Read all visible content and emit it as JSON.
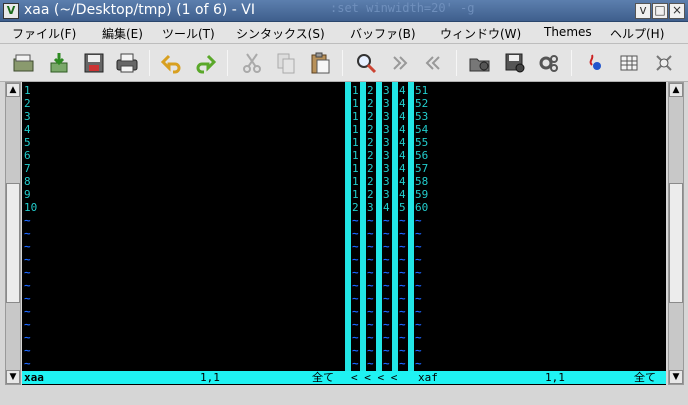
{
  "window": {
    "title": "xaa (~/Desktop/tmp) (1 of 6) - VI",
    "ghost_text": ":set winwidth=20' -g",
    "app_icon": "vim-icon",
    "controls": {
      "minimize": "v",
      "maximize": "□",
      "close": "×"
    }
  },
  "menu": [
    "ファイル(F)",
    "編集(E)",
    "ツール(T)",
    "シンタックス(S)",
    "バッファ(B)",
    "ウィンドウ(W)",
    "Themes",
    "ヘルプ(H)"
  ],
  "toolbar_icons": [
    "open-icon",
    "save-down-icon",
    "save-icon",
    "print-icon",
    "undo-icon",
    "redo-icon",
    "cut-icon",
    "copy-icon",
    "paste-icon",
    "find-replace-icon",
    "forward-icon",
    "back-icon",
    "session-open-icon",
    "session-save-icon",
    "script-icon",
    "make-icon",
    "table-icon",
    "help-icon"
  ],
  "editor": {
    "left_lines": [
      "1",
      "2",
      "3",
      "4",
      "5",
      "6",
      "7",
      "8",
      "9",
      "10"
    ],
    "narrow_rows": [
      [
        "1",
        "2",
        "3",
        "4",
        "51"
      ],
      [
        "1",
        "2",
        "3",
        "4",
        "52"
      ],
      [
        "1",
        "2",
        "3",
        "4",
        "53"
      ],
      [
        "1",
        "2",
        "3",
        "4",
        "54"
      ],
      [
        "1",
        "2",
        "3",
        "4",
        "55"
      ],
      [
        "1",
        "2",
        "3",
        "4",
        "56"
      ],
      [
        "1",
        "2",
        "3",
        "4",
        "57"
      ],
      [
        "1",
        "2",
        "3",
        "4",
        "58"
      ],
      [
        "1",
        "2",
        "3",
        "4",
        "59"
      ],
      [
        "2",
        "3",
        "4",
        "5",
        "60"
      ]
    ],
    "tilde": "~",
    "status": {
      "left_name": "xaa",
      "left_pos": "1,1",
      "left_all": "全て",
      "mids": "< < < <",
      "right_name": "xaf",
      "right_pos": "1,1",
      "right_all": "全て"
    }
  },
  "colors": {
    "text": "#22cccc",
    "tilde": "#1a66ff",
    "statusline": "#1ff2f2",
    "bg": "#000000"
  }
}
